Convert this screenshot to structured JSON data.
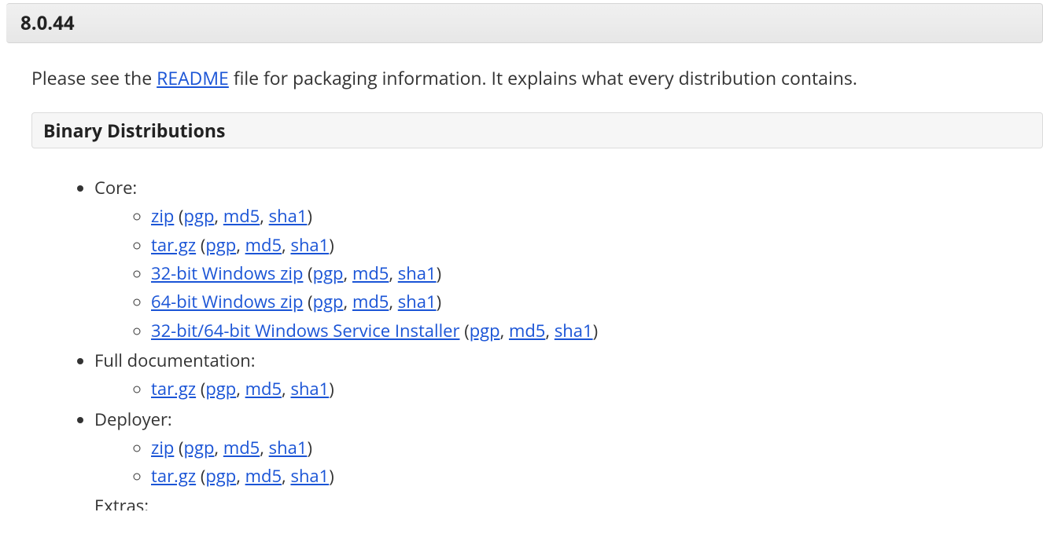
{
  "version": "8.0.44",
  "intro": {
    "before": "Please see the ",
    "readme": "README",
    "after": " file for packaging information. It explains what every distribution contains."
  },
  "section_title": "Binary Distributions",
  "categories": [
    {
      "label": "Core:",
      "items": [
        {
          "name": "zip",
          "sigs": [
            "pgp",
            "md5",
            "sha1"
          ]
        },
        {
          "name": "tar.gz",
          "sigs": [
            "pgp",
            "md5",
            "sha1"
          ]
        },
        {
          "name": "32-bit Windows zip",
          "sigs": [
            "pgp",
            "md5",
            "sha1"
          ]
        },
        {
          "name": "64-bit Windows zip",
          "sigs": [
            "pgp",
            "md5",
            "sha1"
          ]
        },
        {
          "name": "32-bit/64-bit Windows Service Installer",
          "sigs": [
            "pgp",
            "md5",
            "sha1"
          ]
        }
      ]
    },
    {
      "label": "Full documentation:",
      "items": [
        {
          "name": "tar.gz",
          "sigs": [
            "pgp",
            "md5",
            "sha1"
          ]
        }
      ]
    },
    {
      "label": "Deployer:",
      "items": [
        {
          "name": "zip",
          "sigs": [
            "pgp",
            "md5",
            "sha1"
          ]
        },
        {
          "name": "tar.gz",
          "sigs": [
            "pgp",
            "md5",
            "sha1"
          ]
        }
      ]
    },
    {
      "label": "Extras:",
      "items": []
    }
  ]
}
